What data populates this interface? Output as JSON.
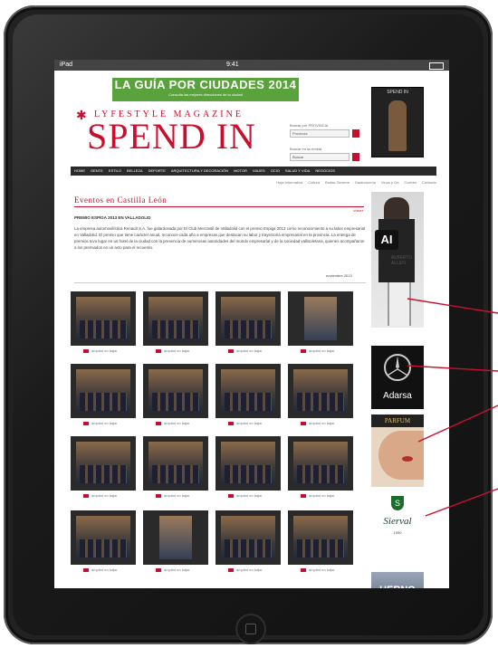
{
  "device": {
    "status_left": "iPad",
    "status_time": "9:41"
  },
  "banner": {
    "title": "LA GUÍA POR CIUDADES 2014",
    "subtitle": "Consulta las mejores direcciones de tu ciudad"
  },
  "cover": {
    "title": "SPEND IN"
  },
  "logo": {
    "tagline": "LYFESTYLE MAGAZINE",
    "name": "SPEND IN"
  },
  "search": {
    "blocks": [
      {
        "label": "Buscar por PROVINCIA",
        "placeholder": "Provincia"
      },
      {
        "label": "Buscar en la revista",
        "placeholder": "Buscar"
      }
    ]
  },
  "nav": {
    "items": [
      "HOME",
      "GENTE",
      "ESTILO",
      "BELLEZA",
      "DEPORTE",
      "ARQUITECTURA Y DECORACIÓN",
      "MOTOR",
      "VIAJES",
      "OCIO",
      "SALUD Y VIDA",
      "NEGOCIOS"
    ]
  },
  "subnav": {
    "items": [
      "Hoja Informativa",
      "Cultura",
      "Bodas Gemma",
      "Gastronomía",
      "Vinos y Ga",
      "Coches",
      "Contacto"
    ]
  },
  "page": {
    "title": "Eventos en Castilla León",
    "back_link": "Volver",
    "article_heading": "PREMIO ESPIGA 2013 EN VALLADOLID",
    "article_body": "La empresa automovilística Renault S.A. fue galardonada por El Club Mercantil de Valladolid con el premio Espiga 2013 como reconocimiento a su labor empresarial en Valladolid. El premio que tiene carácter anual, reconoce cada año a empresas que destacan su labor y trayectoria empresarial en la provincia. La entrega de premios tuvo lugar en un hotel de la ciudad con la presencia de numerosas autoridades del mundo empresarial y de la sociedad vallisoletana, quienes acompañaron a los premiados en un acto para el recuerdo.",
    "article_date": "noviembre 2013"
  },
  "gallery": {
    "caption": "ampliar en bajar",
    "items": [
      {
        "tall": false
      },
      {
        "tall": false
      },
      {
        "tall": false
      },
      {
        "tall": true
      },
      {
        "tall": false
      },
      {
        "tall": false
      },
      {
        "tall": false
      },
      {
        "tall": false
      },
      {
        "tall": false
      },
      {
        "tall": false
      },
      {
        "tall": false
      },
      {
        "tall": false
      },
      {
        "tall": false
      },
      {
        "tall": true
      },
      {
        "tall": false
      },
      {
        "tall": false
      }
    ]
  },
  "ads": {
    "ad1_badge": "AI",
    "ad1_text": "ALBERTO ALLEN",
    "ad2_text": "Adarsa",
    "ad3_top": "PARFUM",
    "ad4_shield": "S",
    "ad4_name": "Sierval",
    "ad4_sub": "1990",
    "ad5_text": "HERNO"
  },
  "colors": {
    "brand_red": "#c8102e",
    "banner_green": "#5aa33c",
    "nav_dark": "#2a2a2a",
    "pointer": "#c8102e"
  }
}
